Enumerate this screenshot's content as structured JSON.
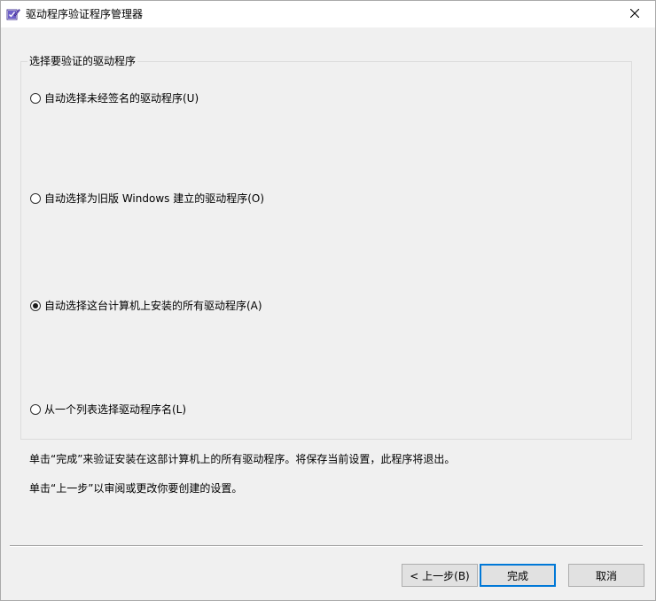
{
  "window": {
    "title": "驱动程序验证程序管理器",
    "app_icon": "checklist-pen-icon",
    "close_icon": "close-icon"
  },
  "group": {
    "legend": "选择要验证的驱动程序",
    "options": [
      {
        "label": "自动选择未经签名的驱动程序(U)",
        "checked": false
      },
      {
        "label": "自动选择为旧版 Windows 建立的驱动程序(O)",
        "checked": false
      },
      {
        "label": "自动选择这台计算机上安装的所有驱动程序(A)",
        "checked": true
      },
      {
        "label": "从一个列表选择驱动程序名(L)",
        "checked": false
      }
    ]
  },
  "info": {
    "line1": "单击“完成”来验证安装在这部计算机上的所有驱动程序。将保存当前设置，此程序将退出。",
    "line2": "单击“上一步”以审阅或更改你要创建的设置。"
  },
  "buttons": {
    "back": "< 上一步(B)",
    "finish": "完成",
    "cancel": "取消"
  },
  "colors": {
    "dialog_bg": "#f0f0f0",
    "titlebar_bg": "#ffffff",
    "accent": "#0078d7",
    "button_bg": "#e1e1e1"
  }
}
